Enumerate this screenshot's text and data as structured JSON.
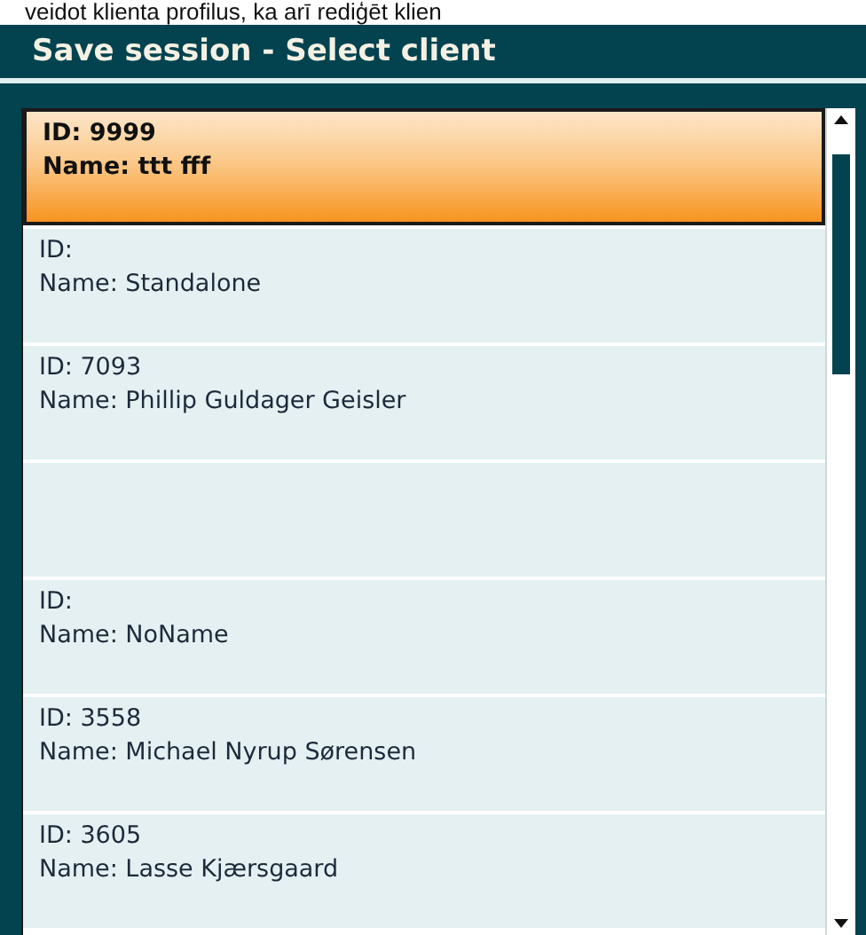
{
  "caption": "veidot klienta profilus, ka arī rediģēt klien",
  "window": {
    "title": "Save session - Select client"
  },
  "clients": [
    {
      "kind": "client",
      "id": "ID: 9999",
      "name": "Name: ttt fff",
      "selected": true
    },
    {
      "kind": "client",
      "id": "ID:",
      "name": "Name: Standalone",
      "selected": false
    },
    {
      "kind": "client",
      "id": "ID: 7093",
      "name": "Name: Phillip Guldager Geisler",
      "selected": false
    },
    {
      "kind": "empty",
      "selected": false
    },
    {
      "kind": "client",
      "id": "ID:",
      "name": "Name: NoName",
      "selected": false
    },
    {
      "kind": "client",
      "id": "ID: 3558",
      "name": "Name: Michael Nyrup Sørensen",
      "selected": false
    },
    {
      "kind": "client",
      "id": "ID: 3605",
      "name": "Name: Lasse Kjærsgaard",
      "selected": false
    }
  ]
}
